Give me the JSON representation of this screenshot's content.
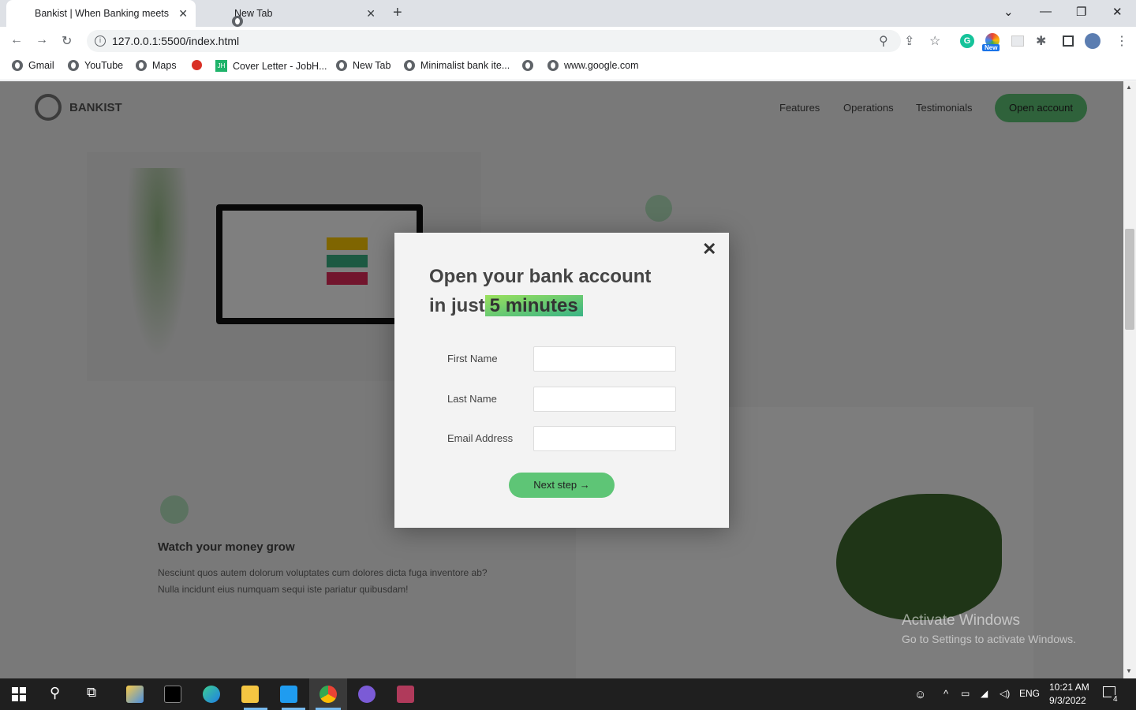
{
  "browser": {
    "tabs": [
      {
        "label": "Bankist | When Banking meets M"
      },
      {
        "label": "New Tab"
      }
    ],
    "new_tab_symbol": "+",
    "url": "127.0.0.1:5500/index.html",
    "extension_badge": "New"
  },
  "bookmarks": [
    {
      "label": "Gmail",
      "icon": "globe-icon"
    },
    {
      "label": "YouTube",
      "icon": "globe-icon"
    },
    {
      "label": "Maps",
      "icon": "globe-icon"
    },
    {
      "label": "",
      "icon": "red-dot-icon"
    },
    {
      "label": "Cover Letter - JobH...",
      "icon": "jh-icon"
    },
    {
      "label": "New Tab",
      "icon": "globe-icon"
    },
    {
      "label": "Minimalist bank ite...",
      "icon": "globe-icon"
    },
    {
      "label": "",
      "icon": "globe-icon"
    },
    {
      "label": "www.google.com",
      "icon": "globe-icon"
    }
  ],
  "page_background": {
    "logo": "BANKIST",
    "nav": [
      "Features",
      "Operations",
      "Testimonials"
    ],
    "cta": "Open account",
    "feature_title": "Watch your money grow",
    "feature_text_1": "Nesciunt quos autem dolorum voluptates cum dolores dicta fuga inventore ab?",
    "feature_text_2": "Nulla incidunt eius numquam sequi iste pariatur quibusdam!"
  },
  "modal": {
    "close_symbol": "✕",
    "title_line1": "Open your bank account",
    "title_line2_prefix": "in just",
    "title_highlight": "5 minutes",
    "fields": [
      {
        "label": "First Name",
        "value": ""
      },
      {
        "label": "Last Name",
        "value": ""
      },
      {
        "label": "Email Address",
        "value": ""
      }
    ],
    "submit_label": "Next step →"
  },
  "watermark": {
    "line1": "Activate Windows",
    "line2": "Go to Settings to activate Windows."
  },
  "taskbar": {
    "language": "ENG",
    "time": "10:21 AM",
    "date": "9/3/2022",
    "notification_count": "4"
  },
  "colors": {
    "accent_green": "#5ec576",
    "overlay": "rgba(0,0,0,0.5)"
  }
}
